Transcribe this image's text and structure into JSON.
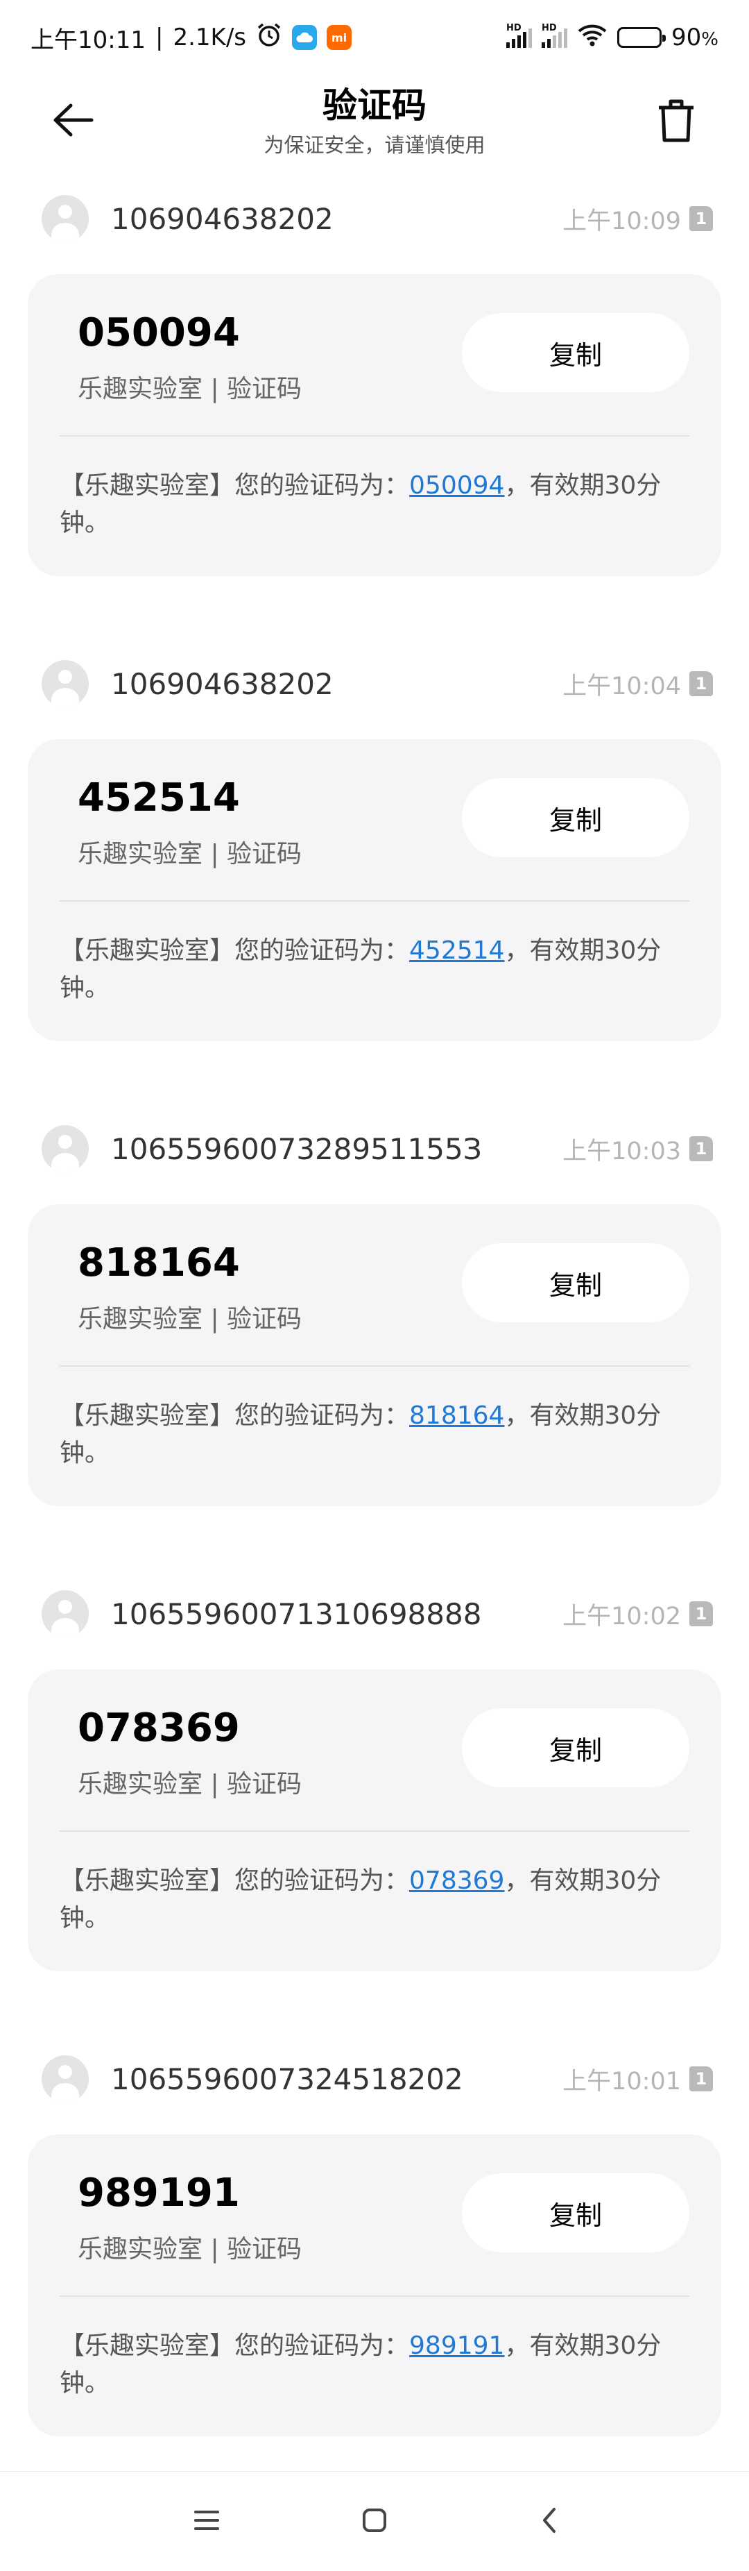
{
  "status_bar": {
    "time": "上午10:11",
    "separator": "|",
    "network_speed": "2.1K/s",
    "battery_percent": "90",
    "battery_unit": "%",
    "battery_level": 0.9,
    "signal_1_label": "HD",
    "signal_2_label": "HD",
    "app_icon_2_text": "mi"
  },
  "header": {
    "title": "验证码",
    "subtitle": "为保证安全，请谨慎使用"
  },
  "copy_label": "复制",
  "messages": [
    {
      "sender": "106904638202",
      "time": "上午10:09",
      "sim": "1",
      "code": "050094",
      "source": "乐趣实验室 | 验证码",
      "body_prefix": "【乐趣实验室】您的验证码为：",
      "body_suffix": "，有效期30分钟。"
    },
    {
      "sender": "106904638202",
      "time": "上午10:04",
      "sim": "1",
      "code": "452514",
      "source": "乐趣实验室 | 验证码",
      "body_prefix": "【乐趣实验室】您的验证码为：",
      "body_suffix": "，有效期30分钟。"
    },
    {
      "sender": "1065596007328951155З",
      "time": "上午10:03",
      "sim": "1",
      "code": "818164",
      "source": "乐趣实验室 | 验证码",
      "body_prefix": "【乐趣实验室】您的验证码为：",
      "body_suffix": "，有效期30分钟。"
    },
    {
      "sender": "1065596007131069888​8",
      "time": "上午10:02",
      "sim": "1",
      "code": "078369",
      "source": "乐趣实验室 | 验证码",
      "body_prefix": "【乐趣实验室】您的验证码为：",
      "body_suffix": "，有效期30分钟。"
    },
    {
      "sender": "1065596007324518202",
      "time": "上午10:01",
      "sim": "1",
      "code": "989191",
      "source": "乐趣实验室 | 验证码",
      "body_prefix": "【乐趣实验室】您的验证码为：",
      "body_suffix": "，有效期30分钟。"
    }
  ],
  "colors": {
    "link": "#1f79d6",
    "card_background": "#f5f5f7",
    "button_background": "#ffffff"
  },
  "icons": {
    "back": "arrow-left-icon",
    "delete": "trash-icon",
    "alarm": "alarm-clock-icon",
    "wifi": "wifi-icon",
    "nav_menu": "menu-icon",
    "nav_home": "home-square-icon",
    "nav_back": "chevron-left-icon"
  }
}
